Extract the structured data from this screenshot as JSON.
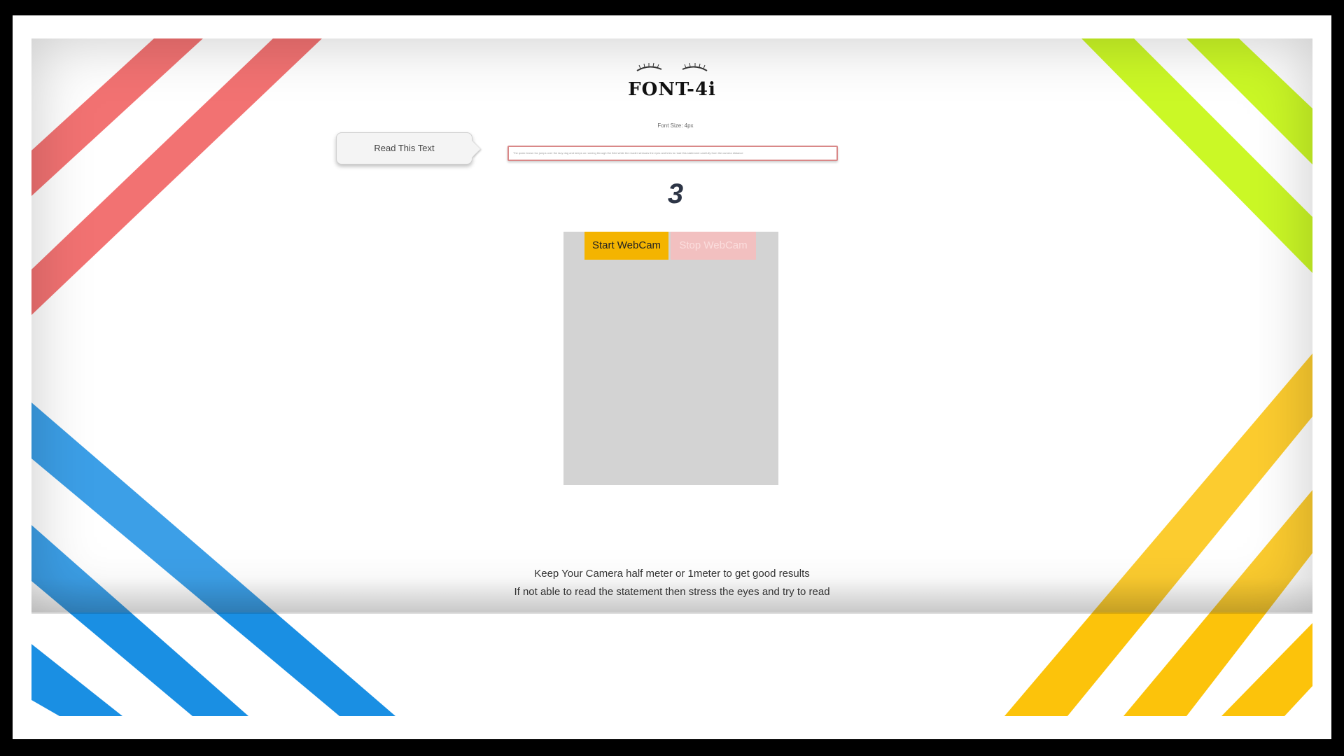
{
  "app": {
    "logo_title": "FONT-4i",
    "font_size_label": "Font Size: 4px"
  },
  "controls": {
    "read_button_label": "Read This Text",
    "text_field_value": "The quick brown fox jumps over the lazy dog and keeps on running through the field while the reader stresses the eyes and tries to read this statement carefully from the camera distance",
    "countdown_value": "3"
  },
  "webcam": {
    "start_label": "Start WebCam",
    "stop_label": "Stop WebCam"
  },
  "instructions": {
    "line1": "Keep Your Camera half meter or 1meter to get good results",
    "line2": "If not able to read the statement then stress the eyes and try to read"
  },
  "colors": {
    "stripe_red": "#f05a5a",
    "stripe_lime": "#c2f700",
    "stripe_blue": "#1a8fe3",
    "stripe_yellow": "#fcc30b",
    "start_button": "#f4b400",
    "stop_button": "#f2c0c0"
  }
}
